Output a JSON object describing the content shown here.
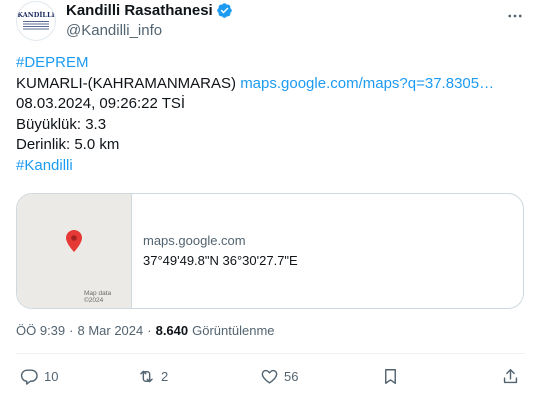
{
  "author": {
    "name": "Kandilli Rasathanesi",
    "handle": "@Kandilli_info",
    "avatar_logo_text": "KANDİLLİ",
    "verified_color": "#1d9bf0"
  },
  "tweet": {
    "hashtag_top": "#DEPREM",
    "location": "KUMARLI-(KAHRAMANMARAS) ",
    "map_link": "maps.google.com/maps?q=37.8305…",
    "datetime": "08.03.2024, 09:26:22 TSİ",
    "magnitude": "Büyüklük: 3.3",
    "depth": "Derinlik: 5.0 km",
    "hashtag_bottom": "#Kandilli"
  },
  "card": {
    "domain": "maps.google.com",
    "coordinates": "37°49'49.8\"N 36°30'27.7\"E",
    "map_credit": "Map data ©2024",
    "map_background": "#eceae6",
    "pin_color": "#e53935"
  },
  "meta": {
    "time": "ÖÖ 9:39",
    "separator": "·",
    "date": "8 Mar 2024",
    "views_count": "8.640",
    "views_label": "Görüntülenme"
  },
  "actions": {
    "reply_count": "10",
    "retweet_count": "2",
    "like_count": "56"
  },
  "colors": {
    "link": "#1d9bf0",
    "text": "#0f1419",
    "secondary": "#536471",
    "border": "#cfd9de"
  }
}
